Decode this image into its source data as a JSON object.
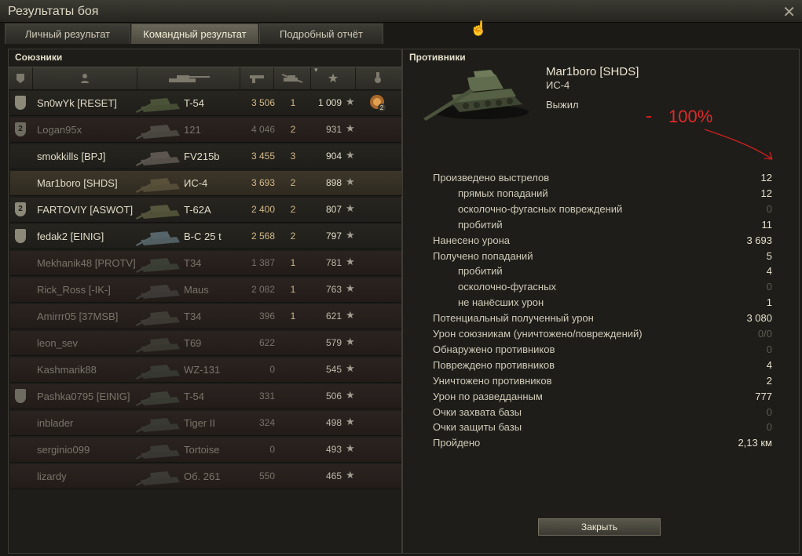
{
  "window": {
    "title": "Результаты боя"
  },
  "tabs": [
    {
      "label": "Личный результат",
      "active": false
    },
    {
      "label": "Командный результат",
      "active": true
    },
    {
      "label": "Подробный отчёт",
      "active": false
    }
  ],
  "allies": {
    "title": "Союзники",
    "header_icons": [
      "platoon-icon",
      "player-icon",
      "tank-icon",
      "damage-icon",
      "kills-icon",
      "sort-arrow-icon",
      "xp-star-icon",
      "medal-icon"
    ],
    "rows": [
      {
        "badge": "",
        "name": "Sn0wYk [RESET]",
        "vehicle": "T-54",
        "damage": "3 506",
        "kills": "1",
        "xp": "1 009",
        "state": "alive",
        "medal": "2"
      },
      {
        "badge": "2",
        "name": "Logan95x",
        "vehicle": "121",
        "damage": "4 046",
        "kills": "2",
        "xp": "931",
        "state": "dead"
      },
      {
        "badge": "",
        "name": "smokkills [BPJ]",
        "vehicle": "FV215b",
        "damage": "3 455",
        "kills": "3",
        "xp": "904",
        "state": "alive"
      },
      {
        "badge": "",
        "name": "Mar1boro [SHDS]",
        "vehicle": "ИС-4",
        "damage": "3 693",
        "kills": "2",
        "xp": "898",
        "state": "self"
      },
      {
        "badge": "2",
        "name": "FARTOVIY [ASWOT]",
        "vehicle": "T-62A",
        "damage": "2 400",
        "kills": "2",
        "xp": "807",
        "state": "alive"
      },
      {
        "badge": "",
        "name": "fedak2 [EINIG]",
        "vehicle": "B-C 25 t",
        "damage": "2 568",
        "kills": "2",
        "xp": "797",
        "state": "alive"
      },
      {
        "badge": "",
        "name": "Mekhanik48 [PROTV]",
        "vehicle": "T34",
        "damage": "1 387",
        "kills": "1",
        "xp": "781",
        "state": "dead"
      },
      {
        "badge": "",
        "name": "Rick_Ross [-IK-]",
        "vehicle": "Maus",
        "damage": "2 082",
        "kills": "1",
        "xp": "763",
        "state": "dead"
      },
      {
        "badge": "",
        "name": "Amirrr05 [37MSB]",
        "vehicle": "T34",
        "damage": "396",
        "kills": "1",
        "xp": "621",
        "state": "dead"
      },
      {
        "badge": "",
        "name": "leon_sev",
        "vehicle": "T69",
        "damage": "622",
        "kills": "",
        "xp": "579",
        "state": "dead"
      },
      {
        "badge": "",
        "name": "Kashmarik88",
        "vehicle": "WZ-131",
        "damage": "0",
        "kills": "",
        "xp": "545",
        "state": "dead"
      },
      {
        "badge": "",
        "name": "Pashka0795 [EINIG]",
        "vehicle": "T-54",
        "damage": "331",
        "kills": "",
        "xp": "506",
        "state": "dead"
      },
      {
        "badge": "",
        "name": "inblader",
        "vehicle": "Tiger II",
        "damage": "324",
        "kills": "",
        "xp": "498",
        "state": "dead"
      },
      {
        "badge": "",
        "name": "serginio099",
        "vehicle": "Tortoise",
        "damage": "0",
        "kills": "",
        "xp": "493",
        "state": "dead"
      },
      {
        "badge": "",
        "name": "lizardy",
        "vehicle": "Об. 261",
        "damage": "550",
        "kills": "",
        "xp": "465",
        "state": "dead"
      }
    ]
  },
  "enemies": {
    "title": "Противники",
    "player": "Mar1boro [SHDS]",
    "vehicle": "ИС-4",
    "status": "Выжил",
    "annotation": "100%",
    "annotation_color": "#e02a2a",
    "stats": [
      {
        "label": "Произведено выстрелов",
        "value": "12",
        "sub": false,
        "zero": false
      },
      {
        "label": "прямых попаданий",
        "value": "12",
        "sub": true,
        "zero": false
      },
      {
        "label": "осколочно-фугасных повреждений",
        "value": "0",
        "sub": true,
        "zero": true
      },
      {
        "label": "пробитий",
        "value": "11",
        "sub": true,
        "zero": false
      },
      {
        "label": "Нанесено урона",
        "value": "3 693",
        "sub": false,
        "zero": false
      },
      {
        "label": "Получено попаданий",
        "value": "5",
        "sub": false,
        "zero": false
      },
      {
        "label": "пробитий",
        "value": "4",
        "sub": true,
        "zero": false
      },
      {
        "label": "осколочно-фугасных",
        "value": "0",
        "sub": true,
        "zero": true
      },
      {
        "label": "не нанёсших урон",
        "value": "1",
        "sub": true,
        "zero": false
      },
      {
        "label": "Потенциальный полученный урон",
        "value": "3 080",
        "sub": false,
        "zero": false
      },
      {
        "label": "Урон союзникам (уничтожено/повреждений)",
        "value": "0/0",
        "sub": false,
        "zero": true
      },
      {
        "label": "Обнаружено противников",
        "value": "0",
        "sub": false,
        "zero": true
      },
      {
        "label": "Повреждено противников",
        "value": "4",
        "sub": false,
        "zero": false
      },
      {
        "label": "Уничтожено противников",
        "value": "2",
        "sub": false,
        "zero": false
      },
      {
        "label": "Урон по разведданным",
        "value": "777",
        "sub": false,
        "zero": false
      },
      {
        "label": "Очки захвата базы",
        "value": "0",
        "sub": false,
        "zero": true
      },
      {
        "label": "Очки защиты базы",
        "value": "0",
        "sub": false,
        "zero": true
      },
      {
        "label": "Пройдено",
        "value": "2,13 км",
        "sub": false,
        "zero": false
      }
    ]
  },
  "buttons": {
    "close": "Закрыть",
    "close_x": "✕"
  },
  "colors": {
    "alive_damage": "#d4b887",
    "dead_text": "#79746a",
    "accent_annotation": "#e02a2a"
  }
}
